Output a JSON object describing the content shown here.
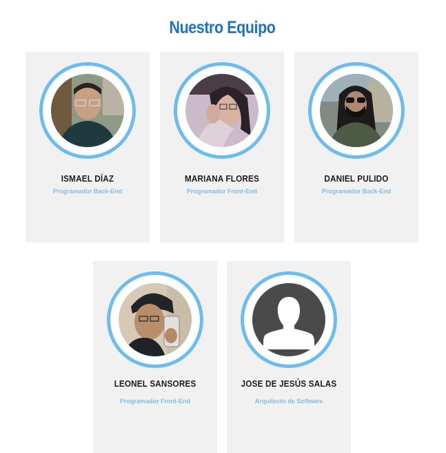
{
  "section": {
    "title": "Nuestro Equipo"
  },
  "members": [
    {
      "name": "ISMAEL DÍAZ",
      "role": "Programador Back-End",
      "avatar": "member-photo"
    },
    {
      "name": "MARIANA FLORES",
      "role": "Programador Front-End",
      "avatar": "member-photo"
    },
    {
      "name": "DANIEL PULIDO",
      "role": "Programador Back-End",
      "avatar": "member-photo"
    },
    {
      "name": "LEONEL SANSORES",
      "role": "Programador Front-End",
      "avatar": "member-photo"
    },
    {
      "name": "JOSE DE JESÚS SALAS",
      "role": "Arquitecto de Software",
      "avatar": "default-user-icon"
    }
  ],
  "colors": {
    "title": "#1a73c9",
    "ring": "#6cbcf0",
    "role": "#7cc0ee",
    "card": "#f1f1f1"
  }
}
